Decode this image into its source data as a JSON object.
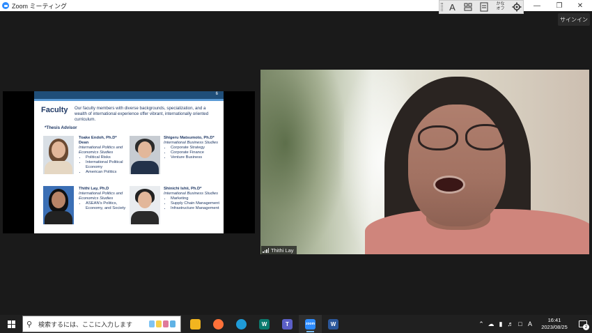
{
  "window": {
    "title": "Zoom ミーティング",
    "controls": {
      "minimize": "—",
      "restore": "❐",
      "close": "✕"
    }
  },
  "ime_toolbar": {
    "font_glyph": "A",
    "kana_top": "かな",
    "kana_bottom": "オフ"
  },
  "signin_label": "サインイン",
  "slide": {
    "page_number": "6",
    "title": "Faculty",
    "intro": "Our faculty members with diverse backgrounds, specialization, and a wealth of international experience offer vibrant, internationally oriented curriculum.",
    "advisor_note": "*Thesis Advisor",
    "faculty": [
      {
        "name": "Toake Endoh, Ph.D*",
        "role": "Dean",
        "dept": "International Politics and Economics Studies",
        "items": [
          "Political Risks",
          "International Political Economy",
          "American Politics"
        ]
      },
      {
        "name": "Shigeru Matsumoto, Ph.D*",
        "role": "",
        "dept": "International Business Studies",
        "items": [
          "Corporate Strategy",
          "Corporate Finance",
          "Venture Business"
        ]
      },
      {
        "name": "Thithi Lay, Ph.D",
        "role": "",
        "dept": "International Politics and Economics Studies",
        "items": [
          "ASEAN's Politics, Economy, and Society"
        ]
      },
      {
        "name": "Shinichi Ishii, Ph.D*",
        "role": "",
        "dept": "International Business Studies",
        "items": [
          "Marketing",
          "Supply Chain Management",
          "Infrastructure Management"
        ]
      }
    ]
  },
  "video": {
    "participant_name": "Thithi Lay"
  },
  "taskbar": {
    "search_placeholder": "検索するには、ここに入力します",
    "apps": [
      {
        "name": "file-explorer",
        "color": "#f2b51f",
        "glyph": "",
        "active": false
      },
      {
        "name": "firefox",
        "color": "#ff7139",
        "glyph": "",
        "active": false
      },
      {
        "name": "edge",
        "color": "#1f9bd7",
        "glyph": "",
        "active": false
      },
      {
        "name": "webex",
        "color": "#0b7a6e",
        "glyph": "W",
        "active": false
      },
      {
        "name": "teams",
        "color": "#5b5fc7",
        "glyph": "T",
        "active": false
      },
      {
        "name": "zoom",
        "color": "#2d8cff",
        "glyph": "zoom",
        "active": true
      },
      {
        "name": "word",
        "color": "#2b579a",
        "glyph": "W",
        "active": false
      }
    ],
    "tray_ime": "A",
    "time": "16:41",
    "date": "2023/08/25",
    "notification_count": "2"
  }
}
